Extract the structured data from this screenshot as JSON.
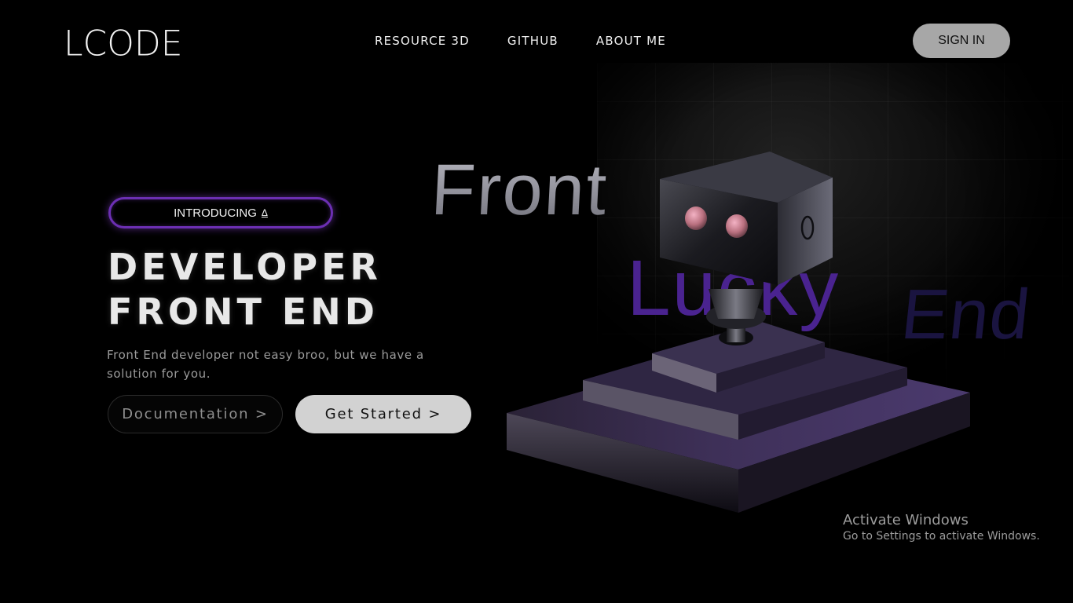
{
  "header": {
    "logo": "LCODE",
    "nav": [
      {
        "label": "RESOURCE 3D"
      },
      {
        "label": "GITHUB"
      },
      {
        "label": "ABOUT ME"
      }
    ],
    "signin_label": "SIGN IN"
  },
  "hero": {
    "badge": "INTRODUCING",
    "badge_glyph": "Δ",
    "title_line1": "DEVELOPER",
    "title_line2": "FRONT END",
    "description": "Front End developer not easy broo, but we have a solution for you.",
    "doc_button": "Documentation >",
    "start_button": "Get Started >"
  },
  "scene": {
    "word1": "Front",
    "word2": "Lucky",
    "word3": "End",
    "robot_label": "3d-robot-illustration",
    "accent": "#6c2fb3"
  },
  "watermark": {
    "title": "Activate Windows",
    "subtitle": "Go to Settings to activate Windows."
  }
}
